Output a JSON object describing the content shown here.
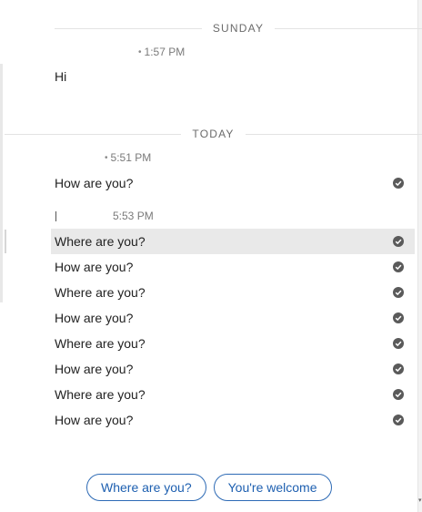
{
  "separators": {
    "sunday": "SUNDAY",
    "today": "TODAY"
  },
  "groups": [
    {
      "time": "1:57 PM"
    },
    {
      "time": "5:51 PM"
    },
    {
      "time": "5:53 PM"
    }
  ],
  "messages": [
    {
      "text": "Hi",
      "status": ""
    },
    {
      "text": "How are you?",
      "status": "delivered-check-icon"
    },
    {
      "text": "Where are you?",
      "status": "delivered-check-icon"
    },
    {
      "text": "How are you?",
      "status": "delivered-check-icon"
    },
    {
      "text": "Where are you?",
      "status": "delivered-check-icon"
    },
    {
      "text": "How are you?",
      "status": "delivered-check-icon"
    },
    {
      "text": "Where are you?",
      "status": "delivered-check-icon"
    },
    {
      "text": "How are you?",
      "status": "delivered-check-icon"
    },
    {
      "text": "Where are you?",
      "status": "delivered-check-icon"
    },
    {
      "text": "How are you?",
      "status": "delivered-check-icon"
    }
  ],
  "quick_replies": [
    {
      "label": "Where are you?"
    },
    {
      "label": "You're welcome"
    }
  ],
  "colors": {
    "accent": "#2d6ab5",
    "highlight": "#e9e9e9",
    "check": "#5a5a5a"
  }
}
